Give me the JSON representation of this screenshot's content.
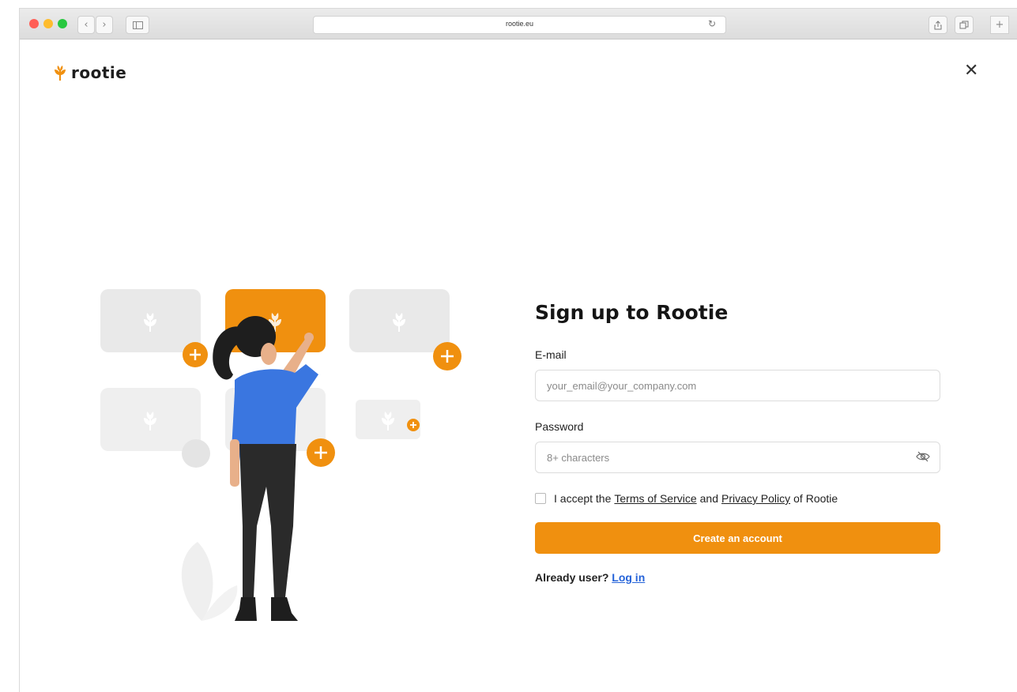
{
  "browser": {
    "url": "rootie.eu"
  },
  "brand": {
    "name": "rootie",
    "accent_color": "#F0900F"
  },
  "form": {
    "title": "Sign up to Rootie",
    "email_label": "E-mail",
    "email_placeholder": "your_email@your_company.com",
    "password_label": "Password",
    "password_placeholder": "8+ characters",
    "terms_prefix": "I accept the",
    "terms_link": "Terms of Service",
    "terms_and": "and",
    "privacy_link": "Privacy Policy",
    "terms_suffix": "of Rootie",
    "submit_label": "Create an account",
    "already_text": "Already user?",
    "login_link": "Log in"
  },
  "icons": {
    "close": "close-icon",
    "password_toggle": "eye-off-icon",
    "logo": "wheat-icon"
  }
}
